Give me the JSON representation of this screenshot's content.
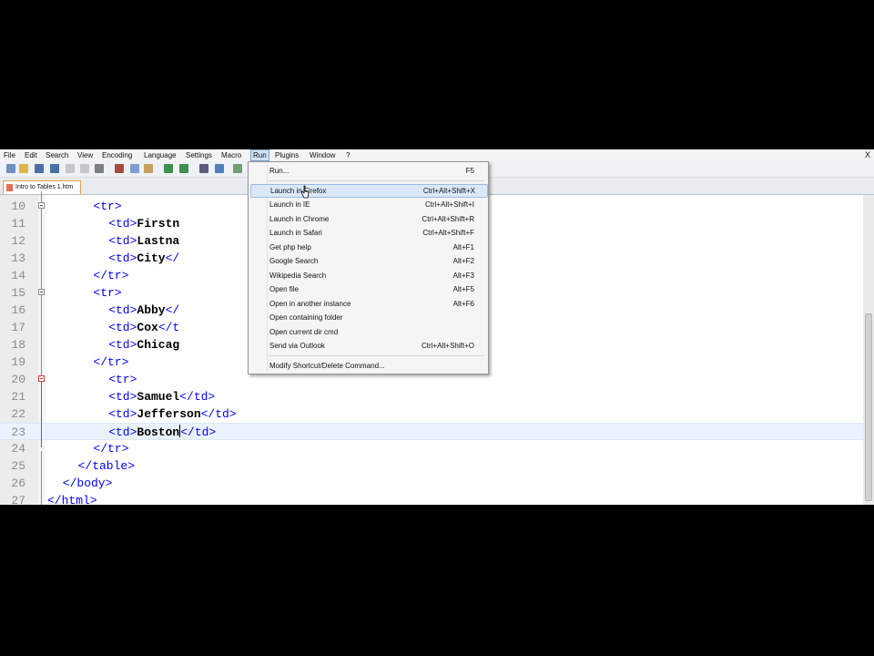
{
  "menubar": {
    "items": [
      "File",
      "Edit",
      "Search",
      "View",
      "Encoding",
      "Language",
      "Settings",
      "Macro",
      "Run",
      "Plugins",
      "Window",
      "?"
    ],
    "active": "Run",
    "close_glyph": "X"
  },
  "tab": {
    "label": "Intro to Tables 1.htm"
  },
  "editor": {
    "lines": [
      {
        "num": "10",
        "code": [
          {
            "t": "tag",
            "v": "<tr>"
          }
        ]
      },
      {
        "num": "11",
        "code": [
          {
            "t": "tag",
            "v": "<td>"
          },
          {
            "t": "txt",
            "v": "Firstn"
          }
        ]
      },
      {
        "num": "12",
        "code": [
          {
            "t": "tag",
            "v": "<td>"
          },
          {
            "t": "txt",
            "v": "Lastna"
          }
        ]
      },
      {
        "num": "13",
        "code": [
          {
            "t": "tag",
            "v": "<td>"
          },
          {
            "t": "txt",
            "v": "City"
          },
          {
            "t": "tag",
            "v": "</"
          }
        ]
      },
      {
        "num": "14",
        "code": [
          {
            "t": "tag",
            "v": "</tr>"
          }
        ]
      },
      {
        "num": "15",
        "code": [
          {
            "t": "tag",
            "v": "<tr>"
          }
        ]
      },
      {
        "num": "16",
        "code": [
          {
            "t": "tag",
            "v": "<td>"
          },
          {
            "t": "txt",
            "v": "Abby"
          },
          {
            "t": "tag",
            "v": "</"
          }
        ]
      },
      {
        "num": "17",
        "code": [
          {
            "t": "tag",
            "v": "<td>"
          },
          {
            "t": "txt",
            "v": "Cox"
          },
          {
            "t": "tag",
            "v": "</t"
          }
        ]
      },
      {
        "num": "18",
        "code": [
          {
            "t": "tag",
            "v": "<td>"
          },
          {
            "t": "txt",
            "v": "Chicag"
          }
        ]
      },
      {
        "num": "19",
        "code": [
          {
            "t": "tag",
            "v": "</tr>"
          }
        ]
      },
      {
        "num": "20",
        "code": [
          {
            "t": "tag",
            "v": "<tr>"
          }
        ]
      },
      {
        "num": "21",
        "code": [
          {
            "t": "tag",
            "v": "<td>"
          },
          {
            "t": "txt",
            "v": "Samuel"
          },
          {
            "t": "tag",
            "v": "</td>"
          }
        ]
      },
      {
        "num": "22",
        "code": [
          {
            "t": "tag",
            "v": "<td>"
          },
          {
            "t": "txt",
            "v": "Jefferson"
          },
          {
            "t": "tag",
            "v": "</td>"
          }
        ]
      },
      {
        "num": "23",
        "code": [
          {
            "t": "tag",
            "v": "<td>"
          },
          {
            "t": "txt",
            "v": "Boston"
          },
          {
            "t": "caret",
            "v": ""
          },
          {
            "t": "tag",
            "v": "</td>"
          }
        ]
      },
      {
        "num": "24",
        "code": [
          {
            "t": "tag",
            "v": "</tr>"
          }
        ]
      },
      {
        "num": "25",
        "code": [
          {
            "t": "tag",
            "v": "</table>"
          }
        ]
      },
      {
        "num": "26",
        "code": [
          {
            "t": "tag",
            "v": "</body>"
          }
        ]
      },
      {
        "num": "27",
        "code": [
          {
            "t": "tag",
            "v": "</html>"
          }
        ]
      }
    ],
    "current_line": "23"
  },
  "run_menu": {
    "items": [
      {
        "label": "Run...",
        "shortcut": "F5"
      },
      {
        "separator": true
      },
      {
        "label": "Launch in Firefox",
        "shortcut": "Ctrl+Alt+Shift+X",
        "hover": true
      },
      {
        "label": "Launch in IE",
        "shortcut": "Ctrl+Alt+Shift+I"
      },
      {
        "label": "Launch in Chrome",
        "shortcut": "Ctrl+Alt+Shift+R"
      },
      {
        "label": "Launch in Safari",
        "shortcut": "Ctrl+Alt+Shift+F"
      },
      {
        "label": "Get php help",
        "shortcut": "Alt+F1"
      },
      {
        "label": "Google Search",
        "shortcut": "Alt+F2"
      },
      {
        "label": "Wikipedia Search",
        "shortcut": "Alt+F3"
      },
      {
        "label": "Open file",
        "shortcut": "Alt+F5"
      },
      {
        "label": "Open in another instance",
        "shortcut": "Alt+F6"
      },
      {
        "label": "Open containing folder",
        "shortcut": ""
      },
      {
        "label": "Open current dir cmd",
        "shortcut": ""
      },
      {
        "label": "Send via Outlook",
        "shortcut": "Ctrl+Alt+Shift+O"
      },
      {
        "separator": true
      },
      {
        "label": "Modify Shortcut/Delete Command...",
        "shortcut": ""
      }
    ]
  },
  "toolbar": {
    "icons": [
      "new-file-icon",
      "open-file-icon",
      "save-icon",
      "save-all-icon",
      "close-icon",
      "close-all-icon",
      "print-icon",
      "cut-icon",
      "copy-icon",
      "paste-icon",
      "undo-icon",
      "redo-icon",
      "find-icon",
      "replace-icon",
      "zoom-icon"
    ]
  },
  "colors": {
    "tag": "#0000ff",
    "text": "#000000",
    "menu_hover": "#dbe8f7",
    "tab_border": "#e6a24a"
  }
}
